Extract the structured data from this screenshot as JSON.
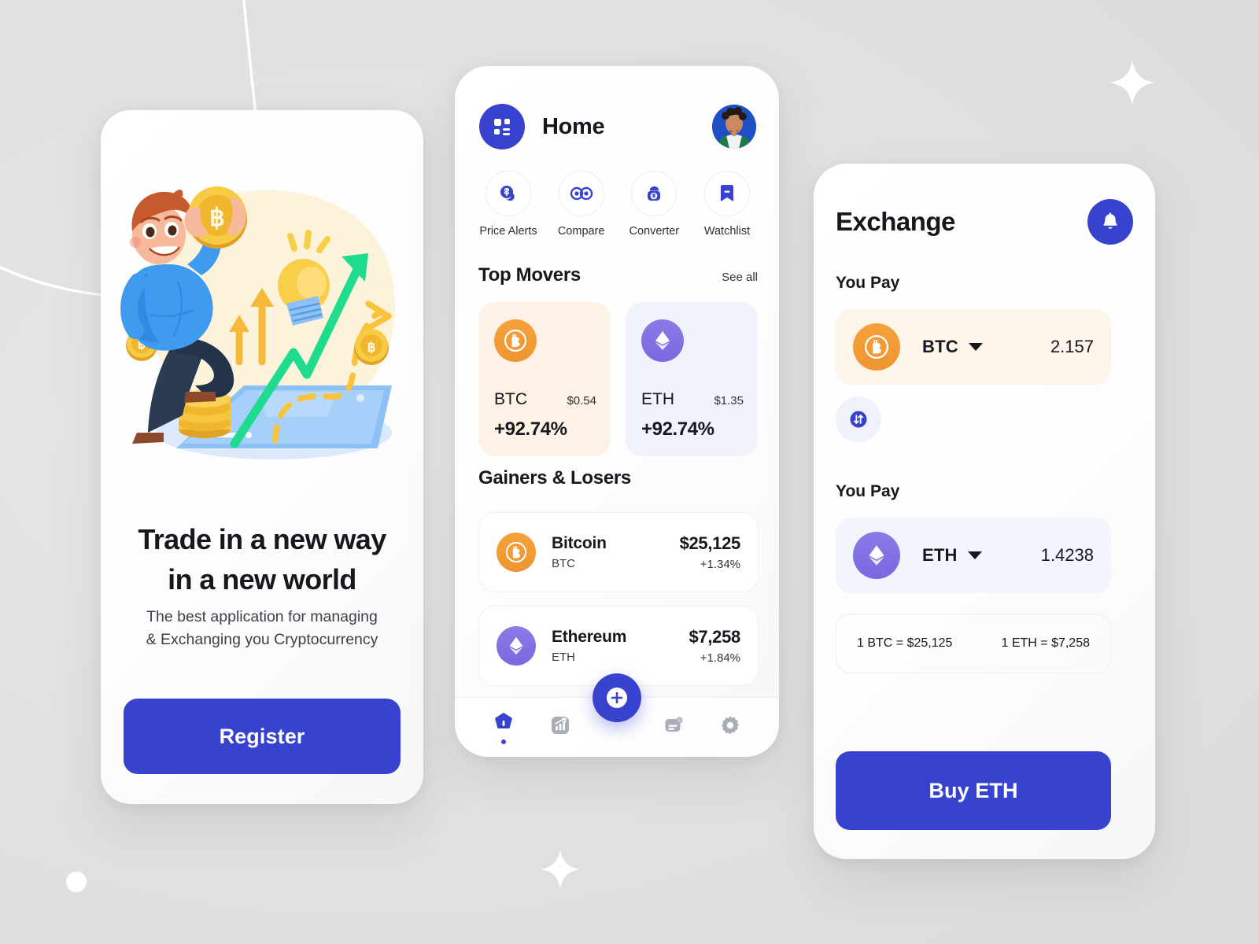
{
  "theme": {
    "brand_blue": "#3742cf",
    "btc_orange": "#ef9530",
    "eth_purple": "#7b68e0",
    "page_bg": "#dcdcdc",
    "btc_card_bg": "#fdf2e5",
    "eth_card_bg": "#f1f3fc"
  },
  "onboarding": {
    "headline_line1": "Trade in a new way",
    "headline_line2": "in a new world",
    "subtext_line1": "The best application for managing",
    "subtext_line2": "& Exchanging you Cryptocurrency",
    "register_label": "Register",
    "illustration_name": "man-holding-bitcoin-growth-chart-illustration"
  },
  "home": {
    "title": "Home",
    "grid_icon": "grid-icon",
    "avatar_icon": "user-avatar",
    "quick_actions": [
      {
        "label": "Price Alerts",
        "icon": "coins-dollar-icon"
      },
      {
        "label": "Compare",
        "icon": "infinity-compare-icon"
      },
      {
        "label": "Converter",
        "icon": "wallet-dollar-icon"
      },
      {
        "label": "Watchlist",
        "icon": "bookmark-icon"
      }
    ],
    "top_movers": {
      "title": "Top Movers",
      "see_all": "See all",
      "cards": [
        {
          "symbol": "BTC",
          "price": "$0.54",
          "change": "+92.74%",
          "icon": "bitcoin-icon",
          "theme": "btc"
        },
        {
          "symbol": "ETH",
          "price": "$1.35",
          "change": "+92.74%",
          "icon": "ethereum-icon",
          "theme": "eth"
        }
      ]
    },
    "gainers_losers": {
      "title": "Gainers & Losers",
      "rows": [
        {
          "name": "Bitcoin",
          "symbol": "BTC",
          "price": "$25,125",
          "change": "+1.34%",
          "icon": "bitcoin-icon",
          "theme": "btc"
        },
        {
          "name": "Ethereum",
          "symbol": "ETH",
          "price": "$7,258",
          "change": "+1.84%",
          "icon": "ethereum-icon",
          "theme": "eth"
        }
      ]
    },
    "tabbar": {
      "fab_icon": "plus-icon",
      "items": [
        {
          "icon": "home-icon",
          "active": true
        },
        {
          "icon": "chart-icon",
          "active": false
        },
        {
          "icon": "news-icon",
          "active": false
        },
        {
          "icon": "settings-gear-icon",
          "active": false
        }
      ]
    }
  },
  "exchange": {
    "title": "Exchange",
    "bell_icon": "bell-icon",
    "pay_label": "You Pay",
    "receive_label": "You Pay",
    "from": {
      "symbol": "BTC",
      "amount": "2.157",
      "icon": "bitcoin-icon"
    },
    "to": {
      "symbol": "ETH",
      "amount": "1.4238",
      "icon": "ethereum-icon"
    },
    "swap_icon": "swap-vertical-icon",
    "rate_left": "1 BTC = $25,125",
    "rate_right": "1 ETH = $7,258",
    "cta_label": "Buy ETH"
  }
}
